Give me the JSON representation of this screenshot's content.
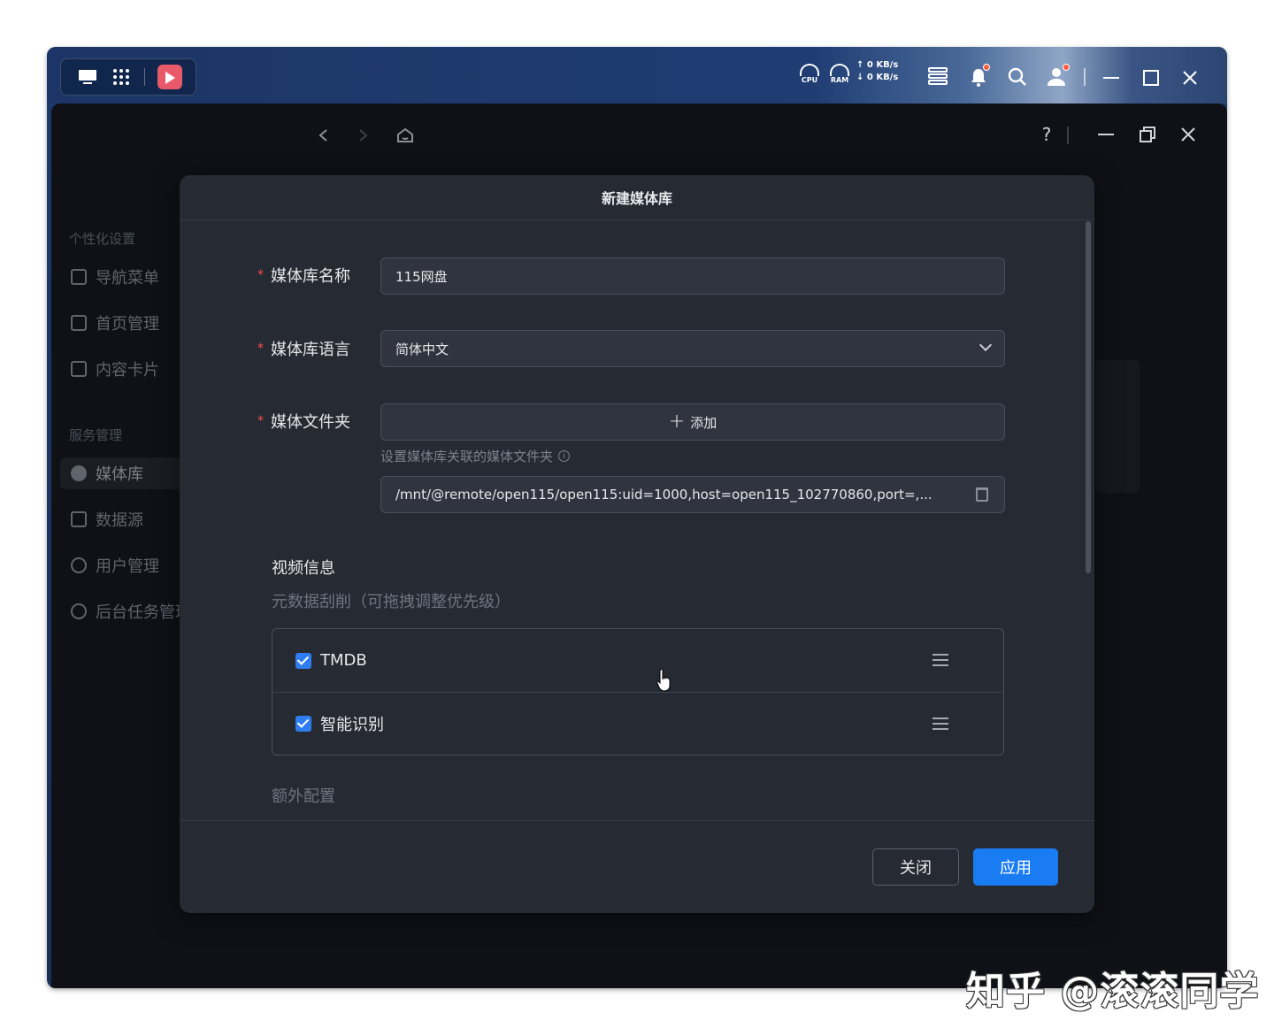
{
  "taskbar": {
    "cpu_label": "CPU",
    "ram_label": "RAM",
    "upload_rate": "0 KB/s",
    "download_rate": "0 KB/s"
  },
  "sidebar": {
    "section1_title": "个性化设置",
    "items1": [
      "导航菜单",
      "首页管理",
      "内容卡片"
    ],
    "section2_title": "服务管理",
    "items2": [
      "媒体库",
      "数据源",
      "用户管理",
      "后台任务管理"
    ]
  },
  "window": {
    "help_label": "?"
  },
  "modal": {
    "title": "新建媒体库",
    "name_label": "媒体库名称",
    "name_value": "115网盘",
    "language_label": "媒体库语言",
    "language_value": "简体中文",
    "folder_label": "媒体文件夹",
    "add_label": "添加",
    "folder_hint": "设置媒体库关联的媒体文件夹",
    "folder_path": "/mnt/@remote/open115/open115:uid=1000,host=open115_102770860,port=,...",
    "video_section": "视频信息",
    "metadata_subtitle": "元数据刮削（可拖拽调整优先级）",
    "providers": [
      "TMDB",
      "智能识别"
    ],
    "extra_section": "额外配置",
    "close_button": "关闭",
    "apply_button": "应用"
  },
  "colors": {
    "accent": "#1a7cf2",
    "required": "#ff4d4f"
  },
  "watermark": "知乎 @滚滚同学"
}
